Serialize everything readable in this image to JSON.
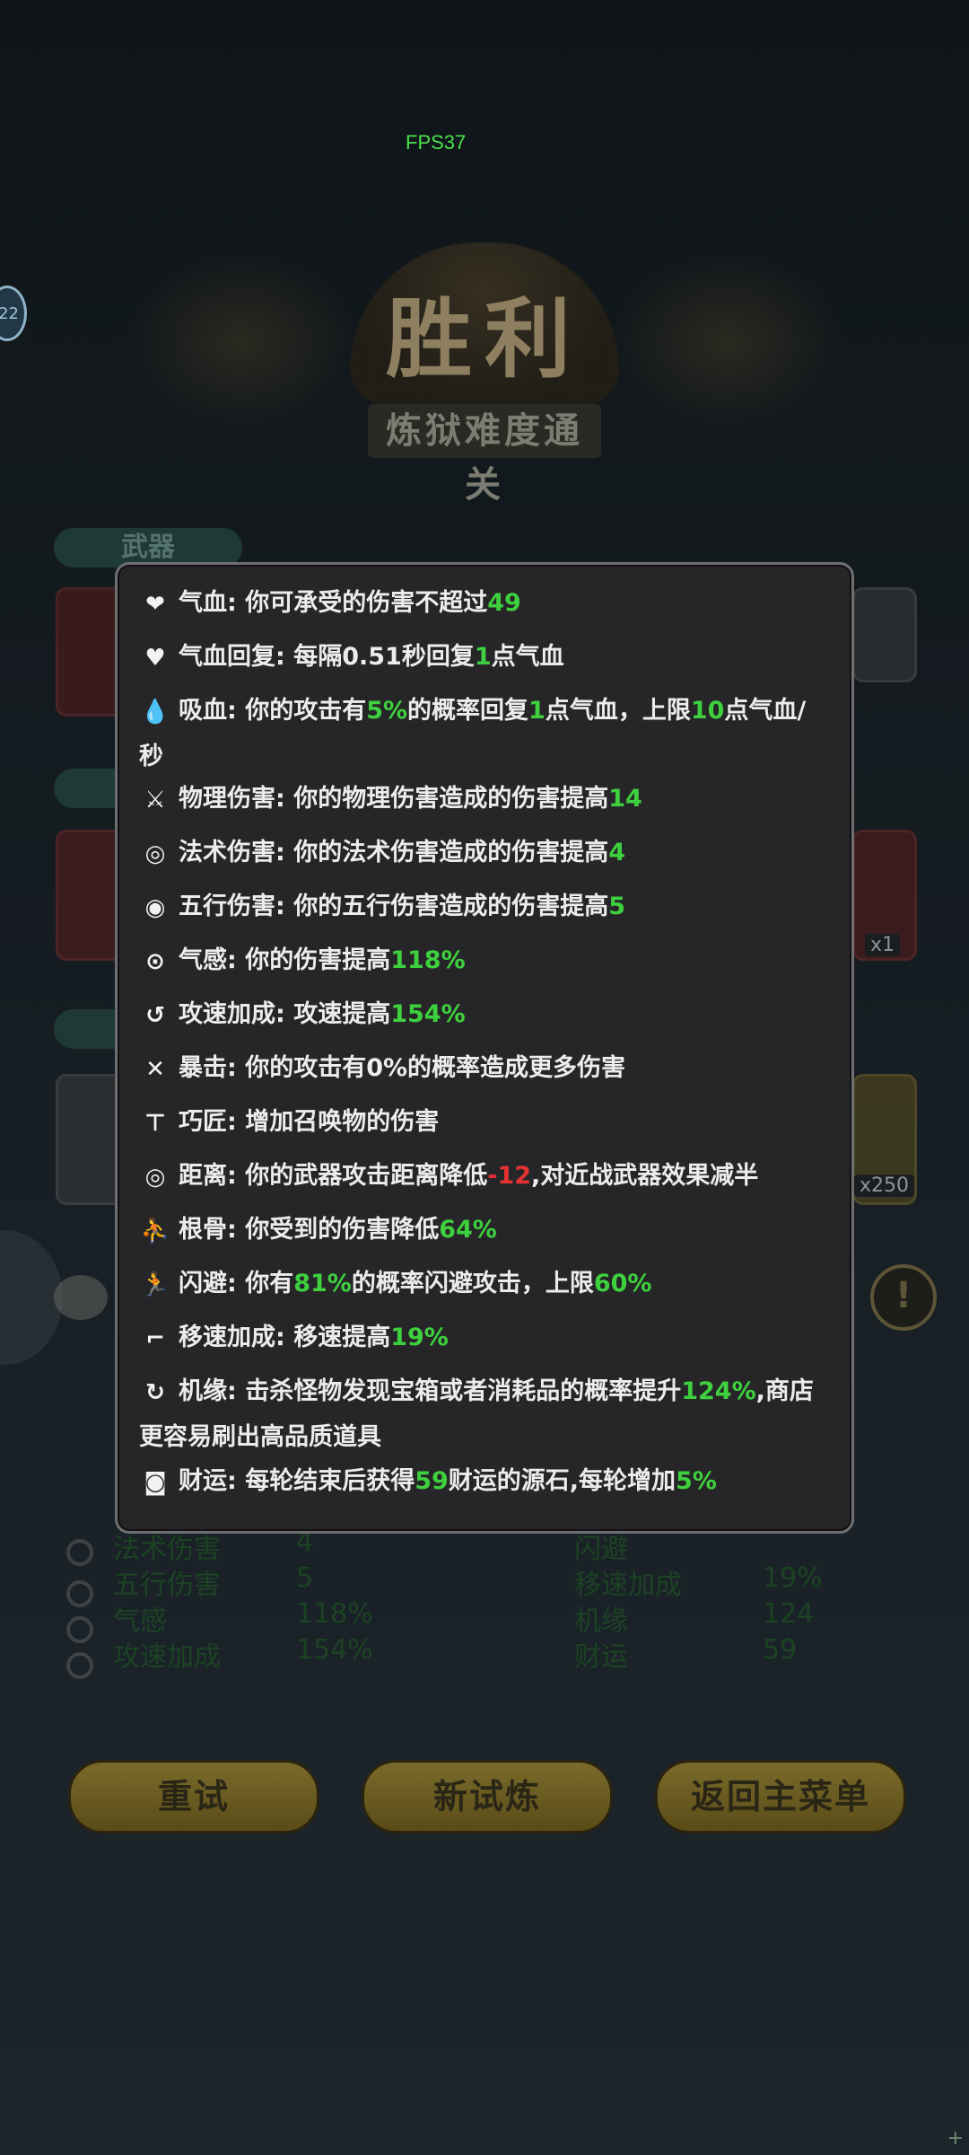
{
  "fps": "FPS37",
  "side_badge": "22",
  "banner": {
    "title": "胜利",
    "subtitle": "炼狱难度通关"
  },
  "sections": {
    "weapons": "武器"
  },
  "inventory": {
    "qty1": "x1",
    "qty2": "x250"
  },
  "tooltip": {
    "stats": [
      {
        "icon": "heart-icon",
        "label": "气血",
        "parts": [
          "你可承受的伤害不超过",
          {
            "v": "49",
            "c": "g"
          }
        ]
      },
      {
        "icon": "heart-regen-icon",
        "label": "气血回复",
        "parts": [
          "每隔0.51秒回复",
          {
            "v": "1",
            "c": "g"
          },
          "点气血"
        ]
      },
      {
        "icon": "blood-drop-icon",
        "label": "吸血",
        "parts": [
          "你的攻击有",
          {
            "v": "5%",
            "c": "g"
          },
          "的概率回复",
          {
            "v": "1",
            "c": "g"
          },
          "点气血，上限",
          {
            "v": "10",
            "c": "g"
          },
          "点气血/秒"
        ]
      },
      {
        "icon": "sword-icon",
        "label": "物理伤害",
        "parts": [
          "你的物理伤害造成的伤害提高",
          {
            "v": "14",
            "c": "g"
          }
        ]
      },
      {
        "icon": "swirl-icon",
        "label": "法术伤害",
        "parts": [
          "你的法术伤害造成的伤害提高",
          {
            "v": "4",
            "c": "g"
          }
        ]
      },
      {
        "icon": "element-icon",
        "label": "五行伤害",
        "parts": [
          "你的五行伤害造成的伤害提高",
          {
            "v": "5",
            "c": "g"
          }
        ]
      },
      {
        "icon": "aura-icon",
        "label": "气感",
        "parts": [
          "你的伤害提高",
          {
            "v": "118%",
            "c": "g"
          }
        ]
      },
      {
        "icon": "attack-speed-icon",
        "label": "攻速加成",
        "parts": [
          "攻速提高",
          {
            "v": "154%",
            "c": "g"
          }
        ]
      },
      {
        "icon": "crit-icon",
        "label": "暴击",
        "parts": [
          "你的攻击有0%的概率造成更多伤害"
        ]
      },
      {
        "icon": "craft-icon",
        "label": "巧匠",
        "parts": [
          "增加召唤物的伤害"
        ]
      },
      {
        "icon": "range-icon",
        "label": "距离",
        "parts": [
          "你的武器攻击距离降低",
          {
            "v": "-12",
            "c": "r"
          },
          ",对近战武器效果减半"
        ]
      },
      {
        "icon": "constitution-icon",
        "label": "根骨",
        "parts": [
          "你受到的伤害降低",
          {
            "v": "64%",
            "c": "g"
          }
        ]
      },
      {
        "icon": "dodge-icon",
        "label": "闪避",
        "parts": [
          "你有",
          {
            "v": "81%",
            "c": "g"
          },
          "的概率闪避攻击，上限",
          {
            "v": "60%",
            "c": "g"
          }
        ]
      },
      {
        "icon": "boot-icon",
        "label": "移速加成",
        "parts": [
          "移速提高",
          {
            "v": "19%",
            "c": "g"
          }
        ]
      },
      {
        "icon": "fortune-icon",
        "label": "机缘",
        "parts": [
          "击杀怪物发现宝箱或者消耗品的概率提升",
          {
            "v": "124%",
            "c": "g"
          },
          ",商店更容易刷出高品质道具"
        ]
      },
      {
        "icon": "coin-icon",
        "label": "财运",
        "parts": [
          "每轮结束后获得",
          {
            "v": "59",
            "c": "g"
          },
          "财运的源石,每轮增加",
          {
            "v": "5%",
            "c": "g"
          }
        ]
      }
    ]
  },
  "background_stats": [
    {
      "label": "法术伤害",
      "value": "4"
    },
    {
      "label": "五行伤害",
      "value": "5"
    },
    {
      "label": "气感",
      "value": "118%"
    },
    {
      "label": "攻速加成",
      "value": "154%"
    },
    {
      "label": "闪避",
      "value": ""
    },
    {
      "label": "移速加成",
      "value": "19%"
    },
    {
      "label": "机缘",
      "value": "124"
    },
    {
      "label": "财运",
      "value": "59"
    }
  ],
  "buttons": {
    "retry": "重试",
    "new_trial": "新试炼",
    "main_menu": "返回主菜单"
  }
}
